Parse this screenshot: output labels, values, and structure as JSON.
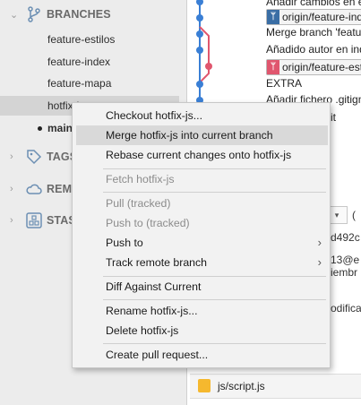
{
  "sidebar": {
    "branches_header": "BRANCHES",
    "branches": [
      {
        "label": "feature-estilos"
      },
      {
        "label": "feature-index"
      },
      {
        "label": "feature-mapa"
      },
      {
        "label": "hotfix-js"
      },
      {
        "label": "main"
      }
    ],
    "tags_header": "TAGS",
    "remotes_header": "REMOTES",
    "stashes_header": "STASHES"
  },
  "commits": [
    {
      "message": "Añadir cambios en el"
    },
    {
      "message": "origin/feature-index",
      "ref_color": "#3a6ea5"
    },
    {
      "message": "Merge branch 'feature"
    },
    {
      "message": "Añadido autor en index"
    },
    {
      "message": "origin/feature-estilos",
      "ref_color": "#e0566e"
    },
    {
      "message": "EXTRA"
    },
    {
      "message": "Añadir fichero .gitignore"
    },
    {
      "message": "it"
    }
  ],
  "details": {
    "hash_fragment": "d492c",
    "email_fragment": "13@e",
    "date_fragment": "iembr",
    "modified_fragment": "odifica",
    "dropdown_label": "(",
    "file_name": "js/script.js"
  },
  "context_menu": {
    "items": [
      {
        "label": "Checkout hotfix-js...",
        "enabled": true
      },
      {
        "label": "Merge hotfix-js into current branch",
        "enabled": true,
        "highlighted": true
      },
      {
        "label": "Rebase current changes onto hotfix-js",
        "enabled": true
      },
      {
        "label": "Fetch hotfix-js",
        "enabled": false
      },
      {
        "label": "Pull  (tracked)",
        "enabled": false
      },
      {
        "label": "Push to  (tracked)",
        "enabled": false
      },
      {
        "label": "Push to",
        "enabled": true,
        "submenu": true
      },
      {
        "label": "Track remote branch",
        "enabled": true,
        "submenu": true
      },
      {
        "label": "Diff Against Current",
        "enabled": true
      },
      {
        "label": "Rename hotfix-js...",
        "enabled": true
      },
      {
        "label": "Delete hotfix-js",
        "enabled": true
      },
      {
        "label": "Create pull request...",
        "enabled": true
      }
    ],
    "submenu_arrow": "›"
  },
  "colors": {
    "graph_blue": "#3a7fd5",
    "graph_pink": "#e0566e",
    "highlight": "#d9d9d9"
  }
}
